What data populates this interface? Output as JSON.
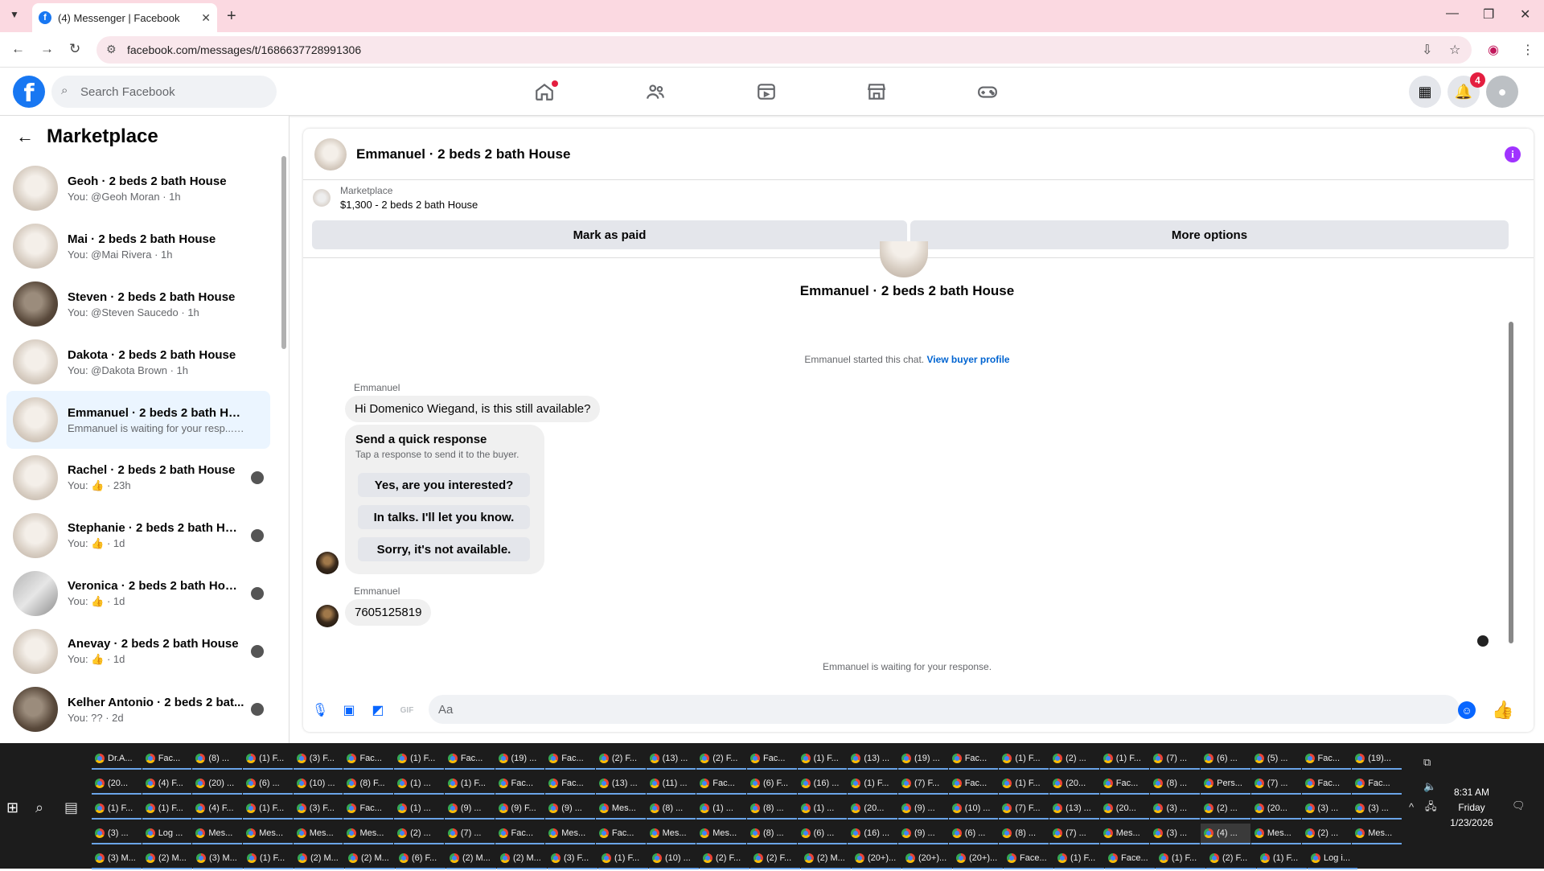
{
  "browser": {
    "tab_title": "(4) Messenger | Facebook",
    "url": "facebook.com/messages/t/1686637728991306"
  },
  "facebook": {
    "search_placeholder": "Search Facebook",
    "notification_count": "4"
  },
  "sidebar": {
    "title": "Marketplace",
    "conversations": [
      {
        "name": "Geoh · 2 beds 2 bath House",
        "sub": "You: @Geoh Moran · 1h",
        "avatar": "house"
      },
      {
        "name": "Mai · 2 beds 2 bath House",
        "sub": "You: @Mai Rivera · 1h",
        "avatar": "house"
      },
      {
        "name": "Steven · 2 beds 2 bath House",
        "sub": "You: @Steven Saucedo · 1h",
        "avatar": "dark"
      },
      {
        "name": "Dakota · 2 beds 2 bath House",
        "sub": "You: @Dakota Brown · 1h",
        "avatar": "house"
      },
      {
        "name": "Emmanuel · 2 beds 2 bath House",
        "sub": "Emmanuel is waiting for your resp... · 11h",
        "avatar": "house",
        "active": true
      },
      {
        "name": "Rachel · 2 beds 2 bath House",
        "sub": "You: 👍 · 23h",
        "avatar": "house"
      },
      {
        "name": "Stephanie · 2 beds 2 bath Hou...",
        "sub": "You: 👍 · 1d",
        "avatar": "house"
      },
      {
        "name": "Veronica · 2 beds 2 bath House",
        "sub": "You: 👍 · 1d",
        "avatar": "grey"
      },
      {
        "name": "Anevay · 2 beds 2 bath House",
        "sub": "You: 👍 · 1d",
        "avatar": "house"
      },
      {
        "name": "Kelher Antonio · 2 beds 2 bat...",
        "sub": "You: ?? · 2d",
        "avatar": "dark"
      }
    ]
  },
  "chat": {
    "title": "Emmanuel · 2 beds 2 bath House",
    "marketplace_label": "Marketplace",
    "listing": "$1,300 - 2 beds 2 bath House",
    "mark_paid": "Mark as paid",
    "more_options": "More options",
    "started_text": "Emmanuel started this chat.",
    "view_profile": "View buyer profile",
    "sender1": "Emmanuel",
    "message1": "Hi Domenico Wiegand, is this still available?",
    "quick_title": "Send a quick response",
    "quick_sub": "Tap a response to send it to the buyer.",
    "quick_replies": [
      "Yes, are you interested?",
      "In talks. I'll let you know.",
      "Sorry, it's not available."
    ],
    "sender2": "Emmanuel",
    "message2": "7605125819",
    "waiting": "Emmanuel is waiting for your response.",
    "composer_placeholder": "Aa"
  },
  "taskbar": {
    "rows": [
      [
        "Dr.A...",
        "Fac...",
        "(8) ...",
        "(1) F...",
        "(3) F...",
        "Fac...",
        "(1) F...",
        "Fac...",
        "(19) ...",
        "Fac...",
        "(2) F...",
        "(13) ...",
        "(2) F...",
        "Fac...",
        "(1) F...",
        "(13) ...",
        "(19) ...",
        "Fac...",
        "(1) F...",
        "(2) ...",
        "(1) F...",
        "(7) ...",
        "(6) ...",
        "(5) ...",
        "Fac...",
        "(19)..."
      ],
      [
        "(20...",
        "(4) F...",
        "(20) ...",
        "(6) ...",
        "(10) ...",
        "(8) F...",
        "(1) ...",
        "(1) F...",
        "Fac...",
        "Fac...",
        "(13) ...",
        "(11) ...",
        "Fac...",
        "(6) F...",
        "(16) ...",
        "(1) F...",
        "(7) F...",
        "Fac...",
        "(1) F...",
        "(20...",
        "Fac...",
        "(8) ...",
        "Pers...",
        "(7) ...",
        "Fac...",
        "Fac..."
      ],
      [
        "(1) F...",
        "(1) F...",
        "(4) F...",
        "(1) F...",
        "(3) F...",
        "Fac...",
        "(1) ...",
        "(9) ...",
        "(9) F...",
        "(9) ...",
        "Mes...",
        "(8) ...",
        "(1) ...",
        "(8) ...",
        "(1) ...",
        "(20...",
        "(9) ...",
        "(10) ...",
        "(7) F...",
        "(13) ...",
        "(20...",
        "(3) ...",
        "(2) ...",
        "(20...",
        "(3) ...",
        "(3) ..."
      ],
      [
        "(3) ...",
        "Log ...",
        "Mes...",
        "Mes...",
        "Mes...",
        "Mes...",
        "(2) ...",
        "(7) ...",
        "Fac...",
        "Mes...",
        "Fac...",
        "Mes...",
        "Mes...",
        "(8) ...",
        "(6) ...",
        "(16) ...",
        "(9) ...",
        "(6) ...",
        "(8) ...",
        "(7) ...",
        "Mes...",
        "(3) ...",
        "(4) ...",
        "Mes...",
        "(2) ...",
        "Mes..."
      ],
      [
        "(3) M...",
        "(2) M...",
        "(3) M...",
        "(1) F...",
        "(2) M...",
        "(2) M...",
        "(6) F...",
        "(2) M...",
        "(2) M...",
        "(3) F...",
        "(1) F...",
        "(10) ...",
        "(2) F...",
        "(2) F...",
        "(2) M...",
        "(20+)...",
        "(20+)...",
        "(20+)...",
        "Face...",
        "(1) F...",
        "Face...",
        "(1) F...",
        "(2) F...",
        "(1) F...",
        "Log i..."
      ]
    ],
    "time": "8:31 AM",
    "day": "Friday",
    "date": "1/23/2026"
  }
}
